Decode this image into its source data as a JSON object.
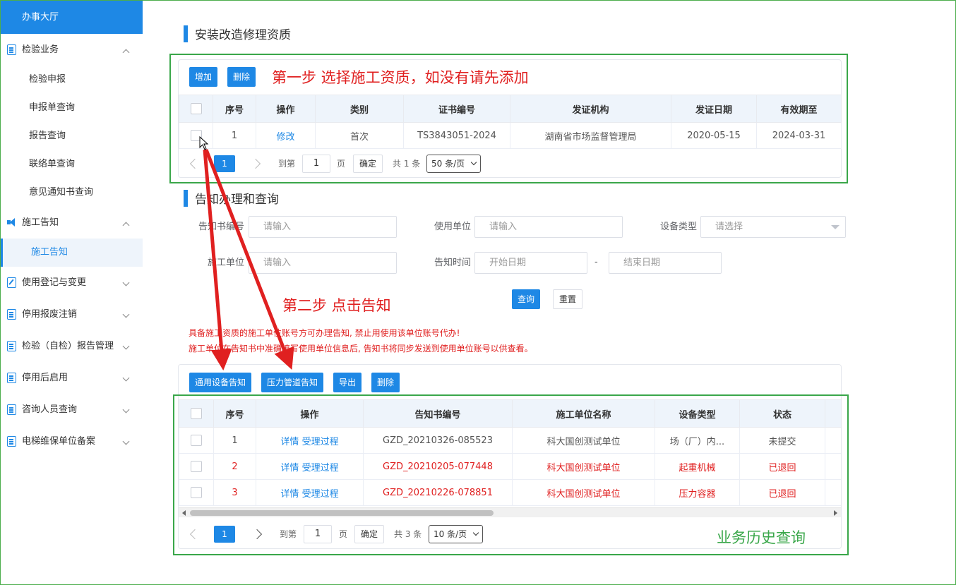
{
  "sidebar": {
    "top": "办事大厅",
    "groups": [
      {
        "label": "检验业务",
        "items": [
          "检验申报",
          "申报单查询",
          "报告查询",
          "联络单查询",
          "意见通知书查询"
        ]
      },
      {
        "label": "施工告知",
        "items": [
          "施工告知"
        ]
      },
      {
        "label": "使用登记与变更"
      },
      {
        "label": "停用报废注销"
      },
      {
        "label": "检验（自检）报告管理"
      },
      {
        "label": "停用后启用"
      },
      {
        "label": "咨询人员查询"
      },
      {
        "label": "电梯维保单位备案"
      }
    ]
  },
  "qual": {
    "title": "安装改造修理资质",
    "add": "增加",
    "del": "删除",
    "annotation": "第一步 选择施工资质，如没有请先添加",
    "headers": [
      "序号",
      "操作",
      "类别",
      "证书编号",
      "发证机构",
      "发证日期",
      "有效期至"
    ],
    "rows": [
      {
        "no": "1",
        "op": "修改",
        "type": "首次",
        "cert": "TS3843051-2024",
        "org": "湖南省市场监督管理局",
        "issue": "2020-05-15",
        "expire": "2024-03-31"
      }
    ],
    "pager": {
      "page": "1",
      "goto": "到第",
      "input": "1",
      "page_unit": "页",
      "confirm": "确定",
      "total": "共 1 条",
      "size": "50 条/页"
    }
  },
  "notice": {
    "title": "告知办理和查询",
    "f1_label": "告知书编号",
    "f1_ph": "请输入",
    "f2_label": "使用单位",
    "f2_ph": "请输入",
    "f3_label": "设备类型",
    "f3_ph": "请选择",
    "f4_label": "施工单位",
    "f4_ph": "请输入",
    "f5_label": "告知时间",
    "f5_start": "开始日期",
    "f5_sep": "-",
    "f5_end": "结束日期",
    "query": "查询",
    "reset": "重置",
    "annotation": "第二步 点击告知",
    "warn1": "具备施工资质的施工单位账号方可办理告知, 禁止用使用该单位账号代办!",
    "warn2": "施工单位在告知书中准确填写使用单位信息后, 告知书将同步发送到使用单位账号以供查看。"
  },
  "history": {
    "btn_general": "通用设备告知",
    "btn_pipe": "压力管道告知",
    "btn_export": "导出",
    "btn_del": "删除",
    "headers": [
      "序号",
      "操作",
      "告知书编号",
      "施工单位名称",
      "设备类型",
      "状态"
    ],
    "op_detail": "详情",
    "op_process": "受理过程",
    "rows": [
      {
        "no": "1",
        "code": "GZD_20210326-085523",
        "unit": "科大国创测试单位",
        "type": "场（厂）内...",
        "status": "未提交",
        "red": false
      },
      {
        "no": "2",
        "code": "GZD_20210205-077448",
        "unit": "科大国创测试单位",
        "type": "起重机械",
        "status": "已退回",
        "red": true
      },
      {
        "no": "3",
        "code": "GZD_20210226-078851",
        "unit": "科大国创测试单位",
        "type": "压力容器",
        "status": "已退回",
        "red": true
      }
    ],
    "pager": {
      "page": "1",
      "goto": "到第",
      "input": "1",
      "page_unit": "页",
      "confirm": "确定",
      "total": "共 3 条",
      "size": "10 条/页"
    },
    "annotation": "业务历史查询"
  },
  "colors": {
    "primary": "#1e88e5",
    "annot_red": "#e02020",
    "annot_green": "#3aa74a"
  }
}
